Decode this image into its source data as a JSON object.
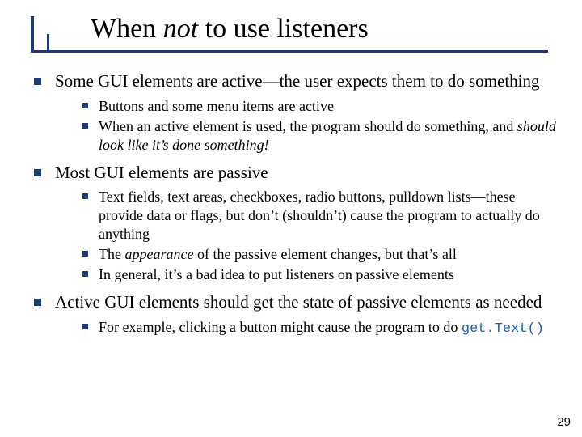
{
  "title": {
    "pre": "When ",
    "em": "not",
    "post": " to use listeners"
  },
  "bullets": {
    "b1": "Some GUI elements are active—the user expects them to do something",
    "b1s1": "Buttons and some menu items are active",
    "b1s2a": "When an active element is used, the program should do something, and ",
    "b1s2b": "should look like it’s done something!",
    "b2": "Most GUI elements are passive",
    "b2s1": "Text fields, text areas, checkboxes, radio buttons, pulldown lists—these provide data or flags, but don’t (shouldn’t) cause the program to actually do anything",
    "b2s2a": "The ",
    "b2s2b": "appearance",
    "b2s2c": " of the passive element changes, but that’s all",
    "b2s3": "In general, it’s a bad idea to put listeners on passive elements",
    "b3": "Active GUI elements should get the state of passive elements as needed",
    "b3s1a": "For example, clicking a button might cause the program to do ",
    "b3s1b": "get.Text()"
  },
  "page": "29"
}
